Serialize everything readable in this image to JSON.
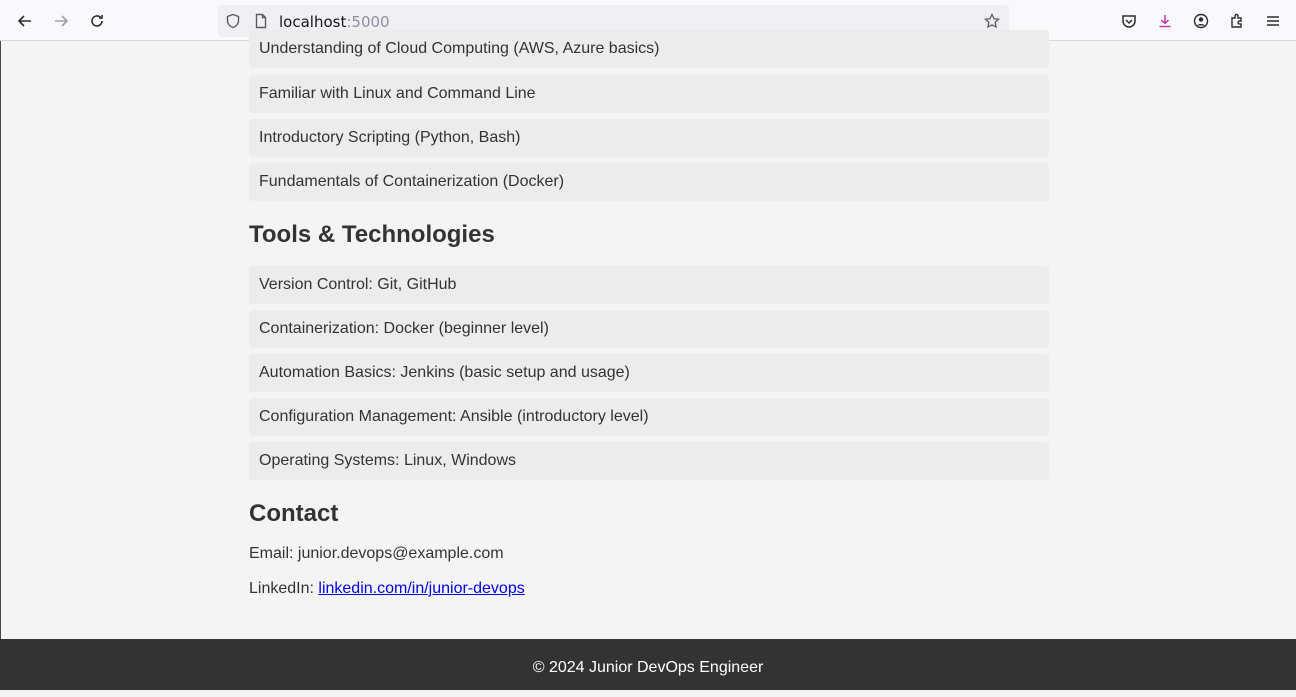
{
  "browser": {
    "url_host": "localhost",
    "url_port": ":5000"
  },
  "skills_items": [
    "Understanding of Cloud Computing (AWS, Azure basics)",
    "Familiar with Linux and Command Line",
    "Introductory Scripting (Python, Bash)",
    "Fundamentals of Containerization (Docker)"
  ],
  "tools": {
    "heading": "Tools & Technologies",
    "items": [
      "Version Control: Git, GitHub",
      "Containerization: Docker (beginner level)",
      "Automation Basics: Jenkins (basic setup and usage)",
      "Configuration Management: Ansible (introductory level)",
      "Operating Systems: Linux, Windows"
    ]
  },
  "contact": {
    "heading": "Contact",
    "email_line": "Email: junior.devops@example.com",
    "linkedin_prefix": "LinkedIn: ",
    "linkedin_link": "linkedin.com/in/junior-devops"
  },
  "footer": {
    "text": "© 2024 Junior DevOps Engineer"
  }
}
